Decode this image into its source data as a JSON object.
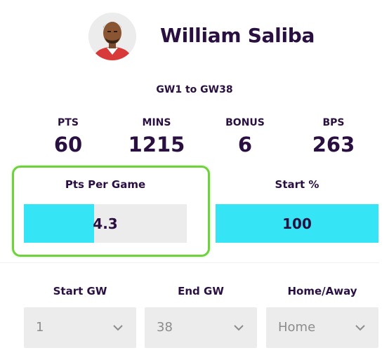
{
  "player": {
    "name": "William Saliba"
  },
  "range": "GW1 to GW38",
  "stats": [
    {
      "label": "PTS",
      "value": "60"
    },
    {
      "label": "MINS",
      "value": "1215"
    },
    {
      "label": "BONUS",
      "value": "6"
    },
    {
      "label": "BPS",
      "value": "263"
    }
  ],
  "metrics": {
    "pts_per_game": {
      "label": "Pts Per Game",
      "value": "4.3",
      "fill_fraction": 0.43
    },
    "start_pct": {
      "label": "Start %",
      "value": "100",
      "fill_fraction": 1.0
    }
  },
  "filters": {
    "start_gw": {
      "label": "Start GW",
      "value": "1"
    },
    "end_gw": {
      "label": "End GW",
      "value": "38"
    },
    "home_away": {
      "label": "Home/Away",
      "value": "Home"
    }
  },
  "colors": {
    "bar_fill": "#36e5f5",
    "highlight": "#6fd13e",
    "text": "#2a1040"
  }
}
